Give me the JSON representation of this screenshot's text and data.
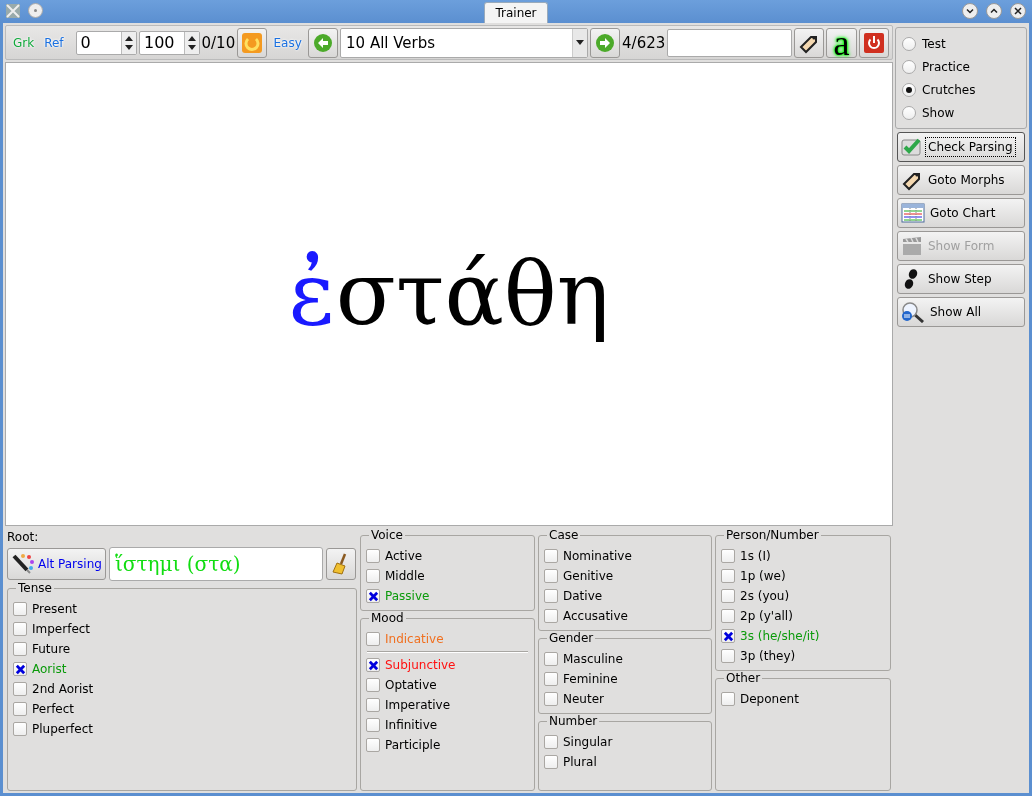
{
  "window": {
    "title": "Trainer"
  },
  "toolbar": {
    "grk_label": {
      "text": "Grk",
      "color": "#0fa83a"
    },
    "ref_label": {
      "text": "Ref",
      "color": "#1a70e0"
    },
    "start_spin": {
      "value": "0"
    },
    "end_spin": {
      "value": "100"
    },
    "range_count": "0/10",
    "easy_label": {
      "text": "Easy",
      "color": "#1a70e0"
    },
    "verb_list": {
      "value": "10 All Verbs"
    },
    "position": "4/623",
    "font_button": "a"
  },
  "display": {
    "word_parts": [
      {
        "text": "ἐ",
        "color": "#1a1aff"
      },
      {
        "text": "στάθη",
        "color": "#000000"
      }
    ]
  },
  "modes": [
    {
      "label": "Test",
      "selected": false
    },
    {
      "label": "Practice",
      "selected": false
    },
    {
      "label": "Crutches",
      "selected": true
    },
    {
      "label": "Show",
      "selected": false
    }
  ],
  "actions": [
    {
      "label": "Check Parsing",
      "kind": "check",
      "disabled": false,
      "focused": true
    },
    {
      "label": "Goto Morphs",
      "kind": "tag",
      "disabled": false,
      "focused": false
    },
    {
      "label": "Goto Chart",
      "kind": "chart",
      "disabled": false,
      "focused": false
    },
    {
      "label": "Show Form",
      "kind": "clapper",
      "disabled": true,
      "focused": false
    },
    {
      "label": "Show Step",
      "kind": "steps",
      "disabled": false,
      "focused": false
    },
    {
      "label": "Show All",
      "kind": "magnifier",
      "disabled": false,
      "focused": false
    }
  ],
  "root": {
    "label": "Root:",
    "alt_parsing": "Alt Parsing",
    "value": "ἵστημι (στα)"
  },
  "groups": [
    {
      "title": "Tense",
      "items": [
        {
          "kind": "checkbox",
          "label": "Present",
          "checked": false,
          "color": "#000000"
        },
        {
          "kind": "checkbox",
          "label": "Imperfect",
          "checked": false,
          "color": "#000000"
        },
        {
          "kind": "checkbox",
          "label": "Future",
          "checked": false,
          "color": "#000000"
        },
        {
          "kind": "checkbox",
          "label": "Aorist",
          "checked": true,
          "color": "#0a9a0a"
        },
        {
          "kind": "checkbox",
          "label": "2nd Aorist",
          "checked": false,
          "color": "#000000"
        },
        {
          "kind": "checkbox",
          "label": "Perfect",
          "checked": false,
          "color": "#000000"
        },
        {
          "kind": "checkbox",
          "label": "Pluperfect",
          "checked": false,
          "color": "#000000"
        }
      ]
    },
    {
      "title": "Voice",
      "items": [
        {
          "kind": "checkbox",
          "label": "Active",
          "checked": false,
          "color": "#000000"
        },
        {
          "kind": "checkbox",
          "label": "Middle",
          "checked": false,
          "color": "#000000"
        },
        {
          "kind": "checkbox",
          "label": "Passive",
          "checked": true,
          "color": "#0a9a0a"
        }
      ]
    },
    {
      "title": "Mood",
      "items": [
        {
          "kind": "checkbox",
          "label": "Indicative",
          "checked": false,
          "color": "#f07020"
        },
        {
          "kind": "separator"
        },
        {
          "kind": "checkbox",
          "label": "Subjunctive",
          "checked": true,
          "color": "#ff1010"
        },
        {
          "kind": "checkbox",
          "label": "Optative",
          "checked": false,
          "color": "#000000"
        },
        {
          "kind": "checkbox",
          "label": "Imperative",
          "checked": false,
          "color": "#000000"
        },
        {
          "kind": "checkbox",
          "label": "Infinitive",
          "checked": false,
          "color": "#000000"
        },
        {
          "kind": "checkbox",
          "label": "Participle",
          "checked": false,
          "color": "#000000"
        }
      ]
    },
    {
      "title": "Case",
      "items": [
        {
          "kind": "checkbox",
          "label": "Nominative",
          "checked": false,
          "color": "#000000"
        },
        {
          "kind": "checkbox",
          "label": "Genitive",
          "checked": false,
          "color": "#000000"
        },
        {
          "kind": "checkbox",
          "label": "Dative",
          "checked": false,
          "color": "#000000"
        },
        {
          "kind": "checkbox",
          "label": "Accusative",
          "checked": false,
          "color": "#000000"
        }
      ]
    },
    {
      "title": "Gender",
      "items": [
        {
          "kind": "checkbox",
          "label": "Masculine",
          "checked": false,
          "color": "#000000"
        },
        {
          "kind": "checkbox",
          "label": "Feminine",
          "checked": false,
          "color": "#000000"
        },
        {
          "kind": "checkbox",
          "label": "Neuter",
          "checked": false,
          "color": "#000000"
        }
      ]
    },
    {
      "title": "Number",
      "items": [
        {
          "kind": "checkbox",
          "label": "Singular",
          "checked": false,
          "color": "#000000"
        },
        {
          "kind": "checkbox",
          "label": "Plural",
          "checked": false,
          "color": "#000000"
        }
      ]
    },
    {
      "title": "Person/Number",
      "items": [
        {
          "kind": "checkbox",
          "label": "1s (I)",
          "checked": false,
          "color": "#000000"
        },
        {
          "kind": "checkbox",
          "label": "1p (we)",
          "checked": false,
          "color": "#000000"
        },
        {
          "kind": "checkbox",
          "label": "2s (you)",
          "checked": false,
          "color": "#000000"
        },
        {
          "kind": "checkbox",
          "label": "2p (y'all)",
          "checked": false,
          "color": "#000000"
        },
        {
          "kind": "checkbox",
          "label": "3s (he/she/it)",
          "checked": true,
          "color": "#0a9a0a"
        },
        {
          "kind": "checkbox",
          "label": "3p (they)",
          "checked": false,
          "color": "#000000"
        }
      ]
    },
    {
      "title": "Other",
      "items": [
        {
          "kind": "checkbox",
          "label": "Deponent",
          "checked": false,
          "color": "#000000"
        }
      ]
    }
  ]
}
